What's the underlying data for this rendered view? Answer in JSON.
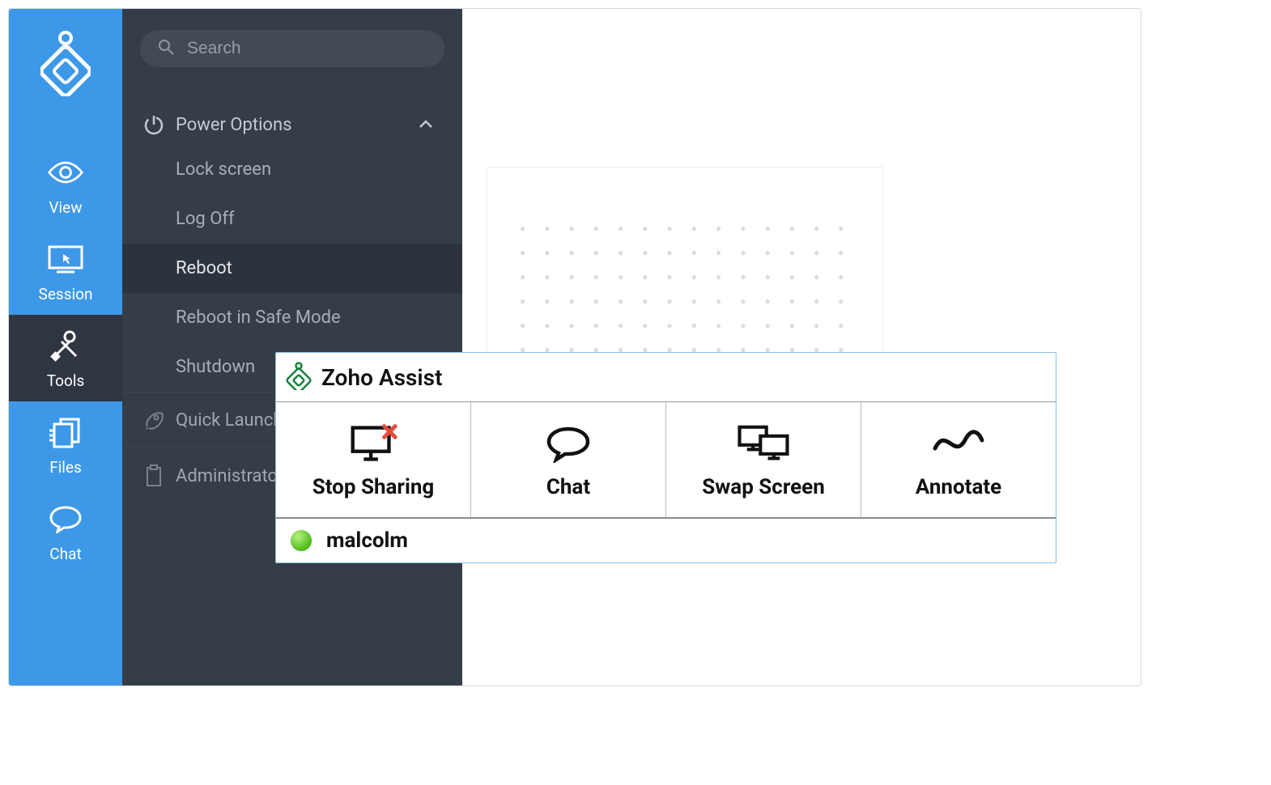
{
  "search": {
    "placeholder": "Search"
  },
  "rail": {
    "view": "View",
    "session": "Session",
    "tools": "Tools",
    "files": "Files",
    "chat": "Chat"
  },
  "menu": {
    "power_label": "Power Options",
    "power_items": {
      "lock": "Lock screen",
      "logoff": "Log Off",
      "reboot": "Reboot",
      "safemode": "Reboot in Safe Mode",
      "shutdown": "Shutdown"
    },
    "quick_launch": "Quick Launch",
    "administrator": "Administrator"
  },
  "panel": {
    "title": "Zoho Assist",
    "buttons": {
      "stop": "Stop Sharing",
      "chat": "Chat",
      "swap": "Swap Screen",
      "annotate": "Annotate"
    },
    "user": "malcolm"
  }
}
